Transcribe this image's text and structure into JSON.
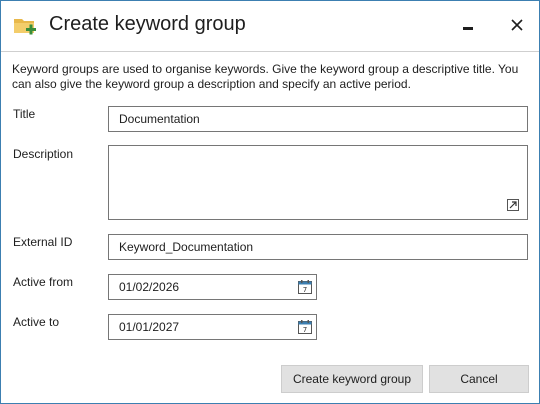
{
  "window": {
    "title": "Create keyword group",
    "icon": "folder-add-icon",
    "minimize_icon": "minimize-icon",
    "close_icon": "close-icon"
  },
  "intro": "Keyword groups are used to organise keywords. Give the keyword group a descriptive title. You can also give the keyword group a description and specify an active period.",
  "form": {
    "title_label": "Title",
    "title_value": "Documentation",
    "description_label": "Description",
    "description_value": "",
    "external_id_label": "External ID",
    "external_id_value": "Keyword_Documentation",
    "active_from_label": "Active from",
    "active_from_value": "01/02/2026",
    "active_to_label": "Active to",
    "active_to_value": "01/01/2027",
    "calendar_icon": "calendar-icon",
    "calendar_day": "7"
  },
  "buttons": {
    "create_label": "Create keyword group",
    "cancel_label": "Cancel"
  },
  "colors": {
    "window_border": "#3c7fb1",
    "folder": "#e8b84a",
    "add_badge": "#3a8e3a",
    "button_bg": "#e1e1e1"
  }
}
